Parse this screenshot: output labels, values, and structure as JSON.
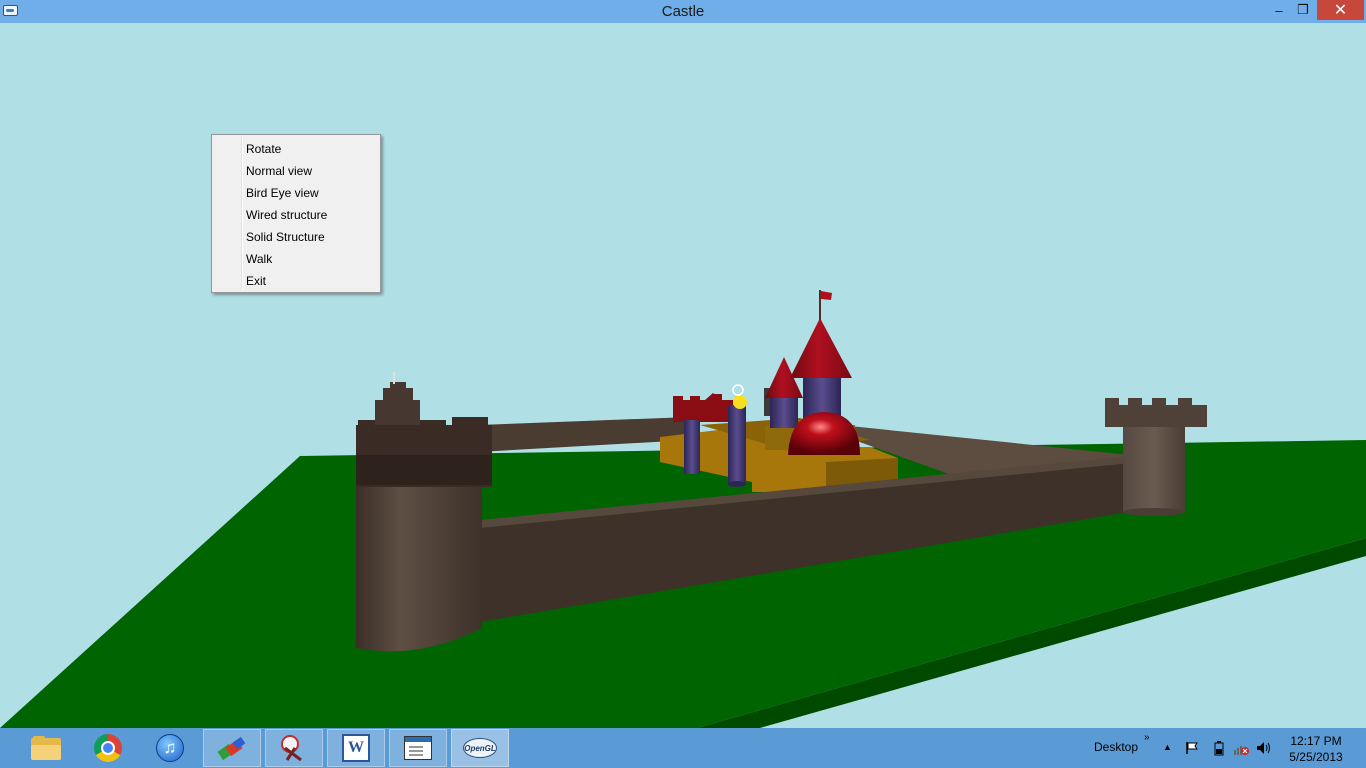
{
  "window": {
    "title": "Castle"
  },
  "title_controls": {
    "minimize": "‒",
    "maximize": "❐",
    "close": "✕"
  },
  "context_menu": {
    "items": [
      "Rotate",
      "Normal view",
      "Bird Eye view",
      "Wired structure",
      "Solid Structure",
      "Walk",
      "Exit"
    ]
  },
  "scene_colors": {
    "sky": "#b0e0e6",
    "ground": "#006400",
    "wall": "#4a3a30",
    "roof": "#a00d16",
    "keep_body": "#4a3e78",
    "building": "#a8770c"
  },
  "taskbar": {
    "apps": [
      "file-explorer-icon",
      "chrome-icon",
      "itunes-icon",
      "paint-app-icon",
      "snipping-tool-icon",
      "word-icon",
      "window-app-icon",
      "opengl-icon"
    ],
    "word_glyph": "W",
    "itunes_glyph": "♫",
    "opengl_label": "OpenGL",
    "desktop_label": "Desktop",
    "chevron": "»",
    "show_hidden": "▲",
    "time": "12:17 PM",
    "date": "5/25/2013"
  }
}
